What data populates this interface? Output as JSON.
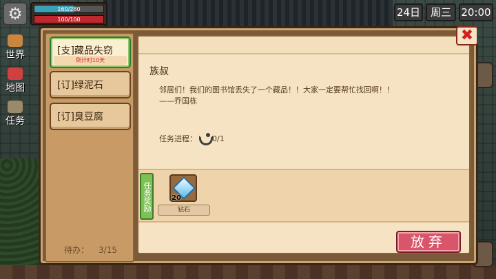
{
  "hud": {
    "hp_text": "160/280",
    "hp_fraction": 0.57,
    "mp_text": "100/100",
    "day": "24日",
    "weekday": "周三",
    "time": "20:00"
  },
  "side_nav": {
    "world": "世界",
    "map": "地图",
    "task": "任务"
  },
  "quests": {
    "tabs": [
      {
        "label": "[支]藏品失窃",
        "countdown": "倒计时10天",
        "active": true
      },
      {
        "label": "[订]绿泥石"
      },
      {
        "label": "[订]臭豆腐"
      }
    ],
    "pending_label": "待办：",
    "pending_value": "3/15"
  },
  "detail": {
    "npc": "族叔",
    "line1": "邻居们！我们的图书馆丢失了一个藏品！！大家一定要帮忙找回啊！！",
    "line2": "——乔国栋",
    "progress_label": "任务进程：",
    "progress_value": "0/1",
    "reward_label": "任务奖励",
    "reward_item": {
      "name": "钻石",
      "count": "20",
      "icon": "diamond-icon"
    },
    "abandon_label": "放弃"
  },
  "colors": {
    "accent_red": "#d9556a",
    "reward_green": "#7cc255",
    "countdown_red": "#d62a2a"
  }
}
